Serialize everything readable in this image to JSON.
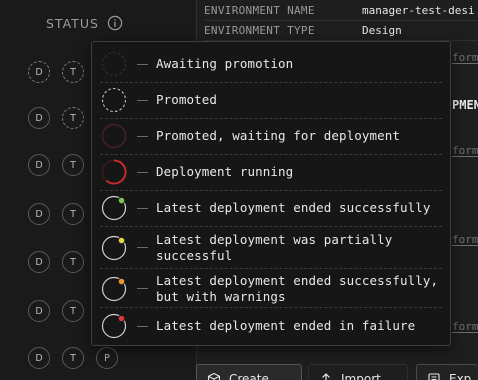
{
  "status_column": {
    "header": "STATUS",
    "rows": [
      [
        "D",
        "T"
      ],
      [
        "D",
        "T"
      ],
      [
        "D",
        "T"
      ],
      [
        "D",
        "T"
      ],
      [
        "D",
        "T"
      ],
      [
        "D",
        "T"
      ],
      [
        "D",
        "T"
      ],
      [
        "D",
        "T",
        "P"
      ]
    ]
  },
  "environment": {
    "rows": [
      {
        "key": "ENVIRONMENT NAME",
        "value": "manager-test-desi"
      },
      {
        "key": "ENVIRONMENT TYPE",
        "value": "Design"
      }
    ],
    "clipped_links": [
      "form",
      "form",
      "form",
      "form",
      "form"
    ],
    "clipped_heading": "PMEN"
  },
  "toolbar": {
    "buttons": [
      {
        "label": "Create",
        "icon": "box-icon"
      },
      {
        "label": "Import",
        "icon": "import-icon"
      },
      {
        "label": "Exp",
        "icon": "export-icon"
      }
    ]
  },
  "legend": {
    "items": [
      {
        "label": "Awaiting promotion",
        "symbol": "awaiting-promotion"
      },
      {
        "label": "Promoted",
        "symbol": "promoted"
      },
      {
        "label": "Promoted, waiting for deployment",
        "symbol": "promoted-waiting"
      },
      {
        "label": "Deployment running",
        "symbol": "deployment-running"
      },
      {
        "label": "Latest deployment ended successfully",
        "symbol": "success",
        "dot_color": "#7cc45a"
      },
      {
        "label": "Latest deployment was partially successful",
        "symbol": "partial",
        "dot_color": "#e6d44a"
      },
      {
        "label": "Latest deployment ended successfully, but with warnings",
        "symbol": "warnings",
        "dot_color": "#e8962e"
      },
      {
        "label": "Latest deployment ended in failure",
        "symbol": "failure",
        "dot_color": "#d93a3a"
      }
    ],
    "colors": {
      "ring": "#cfcfcf",
      "dashed_ring": "#bdbdbd",
      "dark_ring": "#4a2222",
      "running_arc": "#c42b2b"
    }
  }
}
